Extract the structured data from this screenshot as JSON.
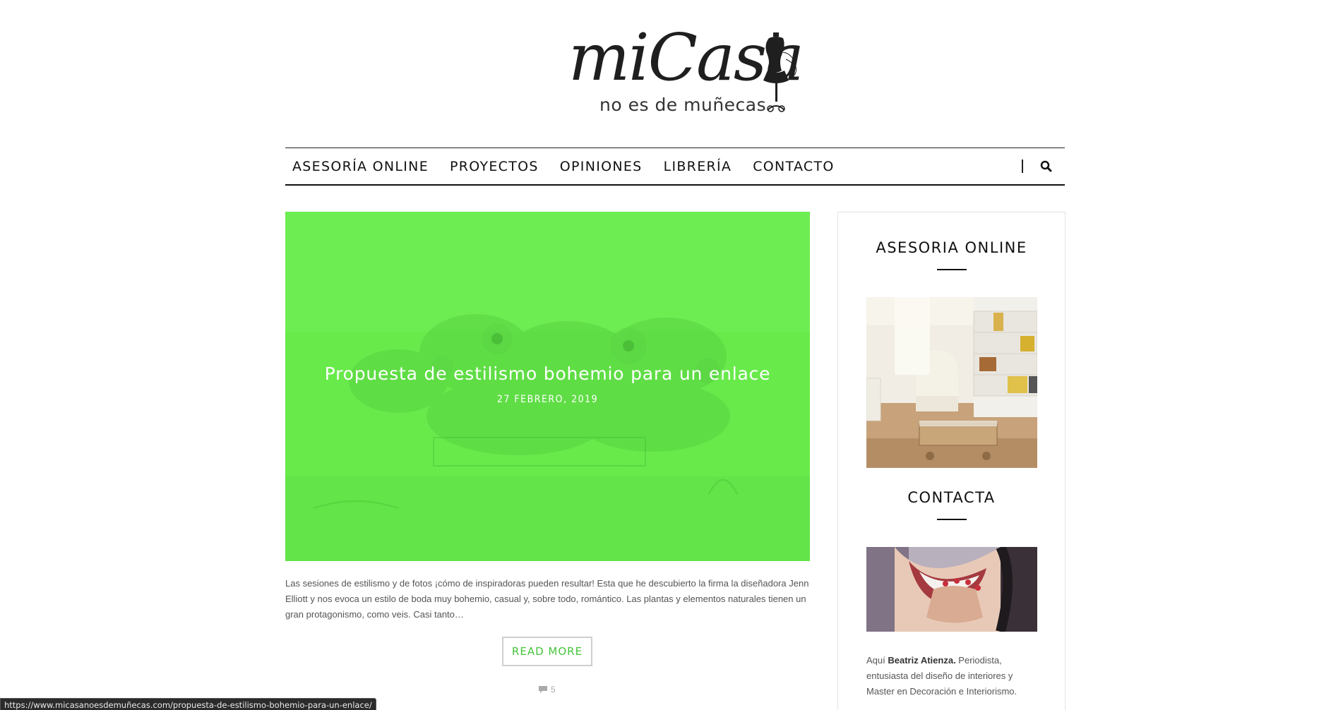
{
  "brand": {
    "script": "miCasa",
    "tagline": "no es de muñecas"
  },
  "nav": {
    "items": [
      "ASESORÍA ONLINE",
      "PROYECTOS",
      "OPINIONES",
      "LIBRERÍA",
      "CONTACTO"
    ],
    "search_icon": "search-icon"
  },
  "post": {
    "title": "Propuesta de estilismo bohemio para un enlace",
    "date": "27 FEBRERO, 2019",
    "excerpt": "Las sesiones de estilismo y de fotos ¡cómo de inspiradoras pueden resultar! Esta que he descubierto la firma la diseñadora Jenn Elliott y nos evoca un estilo de boda muy bohemio, casual y, sobre todo, romántico. Las plantas y elementos naturales tienen un gran protagonismo, como veis. Casi tanto…",
    "read_more": "READ MORE",
    "comment_count": "5",
    "overlay_color": "#68ea4b",
    "accent_color": "#45c53a"
  },
  "sidebar": {
    "widget1_title": "ASESORIA ONLINE",
    "widget2_title": "CONTACTA",
    "bio": {
      "prefix": "Aquí ",
      "name": "Beatriz Atienza.",
      "rest": " Periodista, entusiasta del diseño de interiores y Master en Decoración e Interiorismo."
    }
  },
  "statusbar": {
    "url": "https://www.micasanoesdemuñecas.com/propuesta-de-estilismo-bohemio-para-un-enlace/"
  }
}
